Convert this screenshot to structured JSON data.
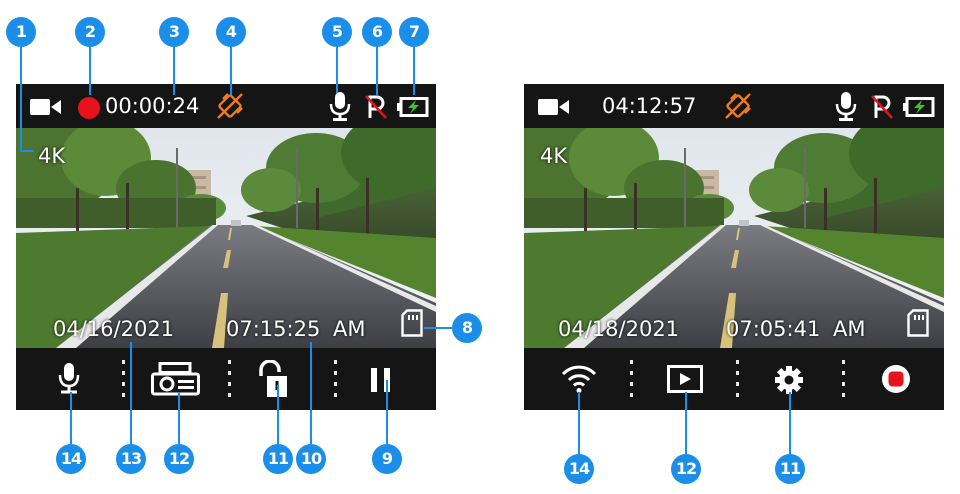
{
  "colors": {
    "callout": "#1a8ee8",
    "record_red": "#e8121c",
    "gps_orange": "#f07a1f",
    "battery_green": "#3ec62d"
  },
  "left_screen": {
    "record_time": "00:00:24",
    "resolution": "4K",
    "date": "04/16/2021",
    "time": "07:15:25",
    "ampm": "AM",
    "status_icons": [
      "video-camera-icon",
      "record-dot-icon",
      "gps-off-icon",
      "microphone-icon",
      "parking-off-icon",
      "battery-charging-icon"
    ],
    "bottom_buttons": [
      "microphone-icon",
      "camera-switch-icon",
      "unlock-icon",
      "pause-icon"
    ],
    "sd_icon": "sd-card-icon"
  },
  "right_screen": {
    "clock_time": "04:12:57",
    "resolution": "4K",
    "date": "04/18/2021",
    "time": "07:05:41",
    "ampm": "AM",
    "status_icons": [
      "video-camera-icon",
      "gps-off-icon",
      "microphone-icon",
      "parking-off-icon",
      "battery-charging-icon"
    ],
    "bottom_buttons": [
      "wifi-icon",
      "playback-icon",
      "settings-gear-icon",
      "record-button-icon"
    ],
    "sd_icon": "sd-card-icon"
  },
  "callouts": {
    "left": [
      "1",
      "2",
      "3",
      "4",
      "5",
      "6",
      "7",
      "8",
      "9",
      "10",
      "11",
      "12",
      "13",
      "14"
    ],
    "right": [
      "14",
      "12",
      "11"
    ]
  }
}
